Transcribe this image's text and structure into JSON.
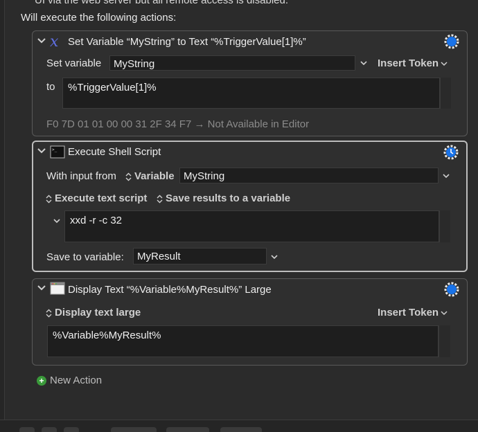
{
  "top_cut_text": "UI via the web server but all remote access is disabled.",
  "intro": "Will execute the following actions:",
  "actions": [
    {
      "title": "Set Variable “MyString” to Text “%TriggerValue[1]%”",
      "set_variable_label": "Set variable",
      "variable_value": "MyString",
      "insert_token_label": "Insert Token",
      "to_label": "to",
      "to_value": "%TriggerValue[1]%",
      "hex_line": "F0 7D 01 01 00 00 31 2F 34 F7 → Not Available in Editor"
    },
    {
      "title": "Execute Shell Script",
      "with_input_label": "With input from",
      "input_source": "Variable",
      "input_variable": "MyString",
      "execute_mode": "Execute text script",
      "results_mode": "Save results to a variable",
      "script": "xxd -r -c 32",
      "save_label": "Save to variable:",
      "save_value": "MyResult"
    },
    {
      "title": "Display Text “%Variable%MyResult%” Large",
      "display_mode": "Display text large",
      "insert_token_label": "Insert Token",
      "text_value": "%Variable%MyResult%"
    }
  ],
  "new_action_label": "New Action",
  "colors": {
    "accent_blue": "#1a73e8",
    "add_green": "#3a9a3a"
  },
  "icons": {
    "set_variable": "variable-x-icon",
    "shell": "terminal-icon",
    "display": "window-icon",
    "gear": "gear-icon",
    "clock_gear": "gear-clock-icon"
  }
}
